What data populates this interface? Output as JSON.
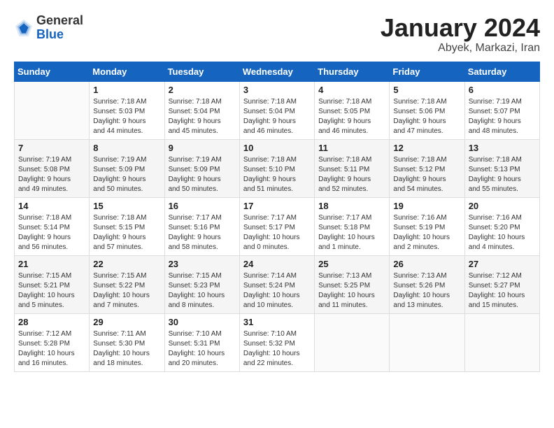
{
  "header": {
    "logo_line1": "General",
    "logo_line2": "Blue",
    "month": "January 2024",
    "location": "Abyek, Markazi, Iran"
  },
  "weekdays": [
    "Sunday",
    "Monday",
    "Tuesday",
    "Wednesday",
    "Thursday",
    "Friday",
    "Saturday"
  ],
  "weeks": [
    [
      {
        "day": "",
        "info": ""
      },
      {
        "day": "1",
        "info": "Sunrise: 7:18 AM\nSunset: 5:03 PM\nDaylight: 9 hours\nand 44 minutes."
      },
      {
        "day": "2",
        "info": "Sunrise: 7:18 AM\nSunset: 5:04 PM\nDaylight: 9 hours\nand 45 minutes."
      },
      {
        "day": "3",
        "info": "Sunrise: 7:18 AM\nSunset: 5:04 PM\nDaylight: 9 hours\nand 46 minutes."
      },
      {
        "day": "4",
        "info": "Sunrise: 7:18 AM\nSunset: 5:05 PM\nDaylight: 9 hours\nand 46 minutes."
      },
      {
        "day": "5",
        "info": "Sunrise: 7:18 AM\nSunset: 5:06 PM\nDaylight: 9 hours\nand 47 minutes."
      },
      {
        "day": "6",
        "info": "Sunrise: 7:19 AM\nSunset: 5:07 PM\nDaylight: 9 hours\nand 48 minutes."
      }
    ],
    [
      {
        "day": "7",
        "info": "Sunrise: 7:19 AM\nSunset: 5:08 PM\nDaylight: 9 hours\nand 49 minutes."
      },
      {
        "day": "8",
        "info": "Sunrise: 7:19 AM\nSunset: 5:09 PM\nDaylight: 9 hours\nand 50 minutes."
      },
      {
        "day": "9",
        "info": "Sunrise: 7:19 AM\nSunset: 5:09 PM\nDaylight: 9 hours\nand 50 minutes."
      },
      {
        "day": "10",
        "info": "Sunrise: 7:18 AM\nSunset: 5:10 PM\nDaylight: 9 hours\nand 51 minutes."
      },
      {
        "day": "11",
        "info": "Sunrise: 7:18 AM\nSunset: 5:11 PM\nDaylight: 9 hours\nand 52 minutes."
      },
      {
        "day": "12",
        "info": "Sunrise: 7:18 AM\nSunset: 5:12 PM\nDaylight: 9 hours\nand 54 minutes."
      },
      {
        "day": "13",
        "info": "Sunrise: 7:18 AM\nSunset: 5:13 PM\nDaylight: 9 hours\nand 55 minutes."
      }
    ],
    [
      {
        "day": "14",
        "info": "Sunrise: 7:18 AM\nSunset: 5:14 PM\nDaylight: 9 hours\nand 56 minutes."
      },
      {
        "day": "15",
        "info": "Sunrise: 7:18 AM\nSunset: 5:15 PM\nDaylight: 9 hours\nand 57 minutes."
      },
      {
        "day": "16",
        "info": "Sunrise: 7:17 AM\nSunset: 5:16 PM\nDaylight: 9 hours\nand 58 minutes."
      },
      {
        "day": "17",
        "info": "Sunrise: 7:17 AM\nSunset: 5:17 PM\nDaylight: 10 hours\nand 0 minutes."
      },
      {
        "day": "18",
        "info": "Sunrise: 7:17 AM\nSunset: 5:18 PM\nDaylight: 10 hours\nand 1 minute."
      },
      {
        "day": "19",
        "info": "Sunrise: 7:16 AM\nSunset: 5:19 PM\nDaylight: 10 hours\nand 2 minutes."
      },
      {
        "day": "20",
        "info": "Sunrise: 7:16 AM\nSunset: 5:20 PM\nDaylight: 10 hours\nand 4 minutes."
      }
    ],
    [
      {
        "day": "21",
        "info": "Sunrise: 7:15 AM\nSunset: 5:21 PM\nDaylight: 10 hours\nand 5 minutes."
      },
      {
        "day": "22",
        "info": "Sunrise: 7:15 AM\nSunset: 5:22 PM\nDaylight: 10 hours\nand 7 minutes."
      },
      {
        "day": "23",
        "info": "Sunrise: 7:15 AM\nSunset: 5:23 PM\nDaylight: 10 hours\nand 8 minutes."
      },
      {
        "day": "24",
        "info": "Sunrise: 7:14 AM\nSunset: 5:24 PM\nDaylight: 10 hours\nand 10 minutes."
      },
      {
        "day": "25",
        "info": "Sunrise: 7:13 AM\nSunset: 5:25 PM\nDaylight: 10 hours\nand 11 minutes."
      },
      {
        "day": "26",
        "info": "Sunrise: 7:13 AM\nSunset: 5:26 PM\nDaylight: 10 hours\nand 13 minutes."
      },
      {
        "day": "27",
        "info": "Sunrise: 7:12 AM\nSunset: 5:27 PM\nDaylight: 10 hours\nand 15 minutes."
      }
    ],
    [
      {
        "day": "28",
        "info": "Sunrise: 7:12 AM\nSunset: 5:28 PM\nDaylight: 10 hours\nand 16 minutes."
      },
      {
        "day": "29",
        "info": "Sunrise: 7:11 AM\nSunset: 5:30 PM\nDaylight: 10 hours\nand 18 minutes."
      },
      {
        "day": "30",
        "info": "Sunrise: 7:10 AM\nSunset: 5:31 PM\nDaylight: 10 hours\nand 20 minutes."
      },
      {
        "day": "31",
        "info": "Sunrise: 7:10 AM\nSunset: 5:32 PM\nDaylight: 10 hours\nand 22 minutes."
      },
      {
        "day": "",
        "info": ""
      },
      {
        "day": "",
        "info": ""
      },
      {
        "day": "",
        "info": ""
      }
    ]
  ]
}
